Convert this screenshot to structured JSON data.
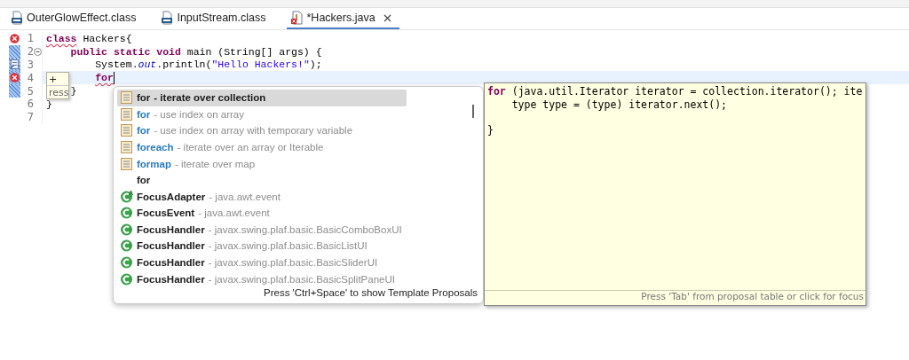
{
  "tabs": [
    {
      "label": "OuterGlowEffect.class",
      "kind": "class-file",
      "selected": false
    },
    {
      "label": "InputStream.class",
      "kind": "class-file",
      "selected": false
    },
    {
      "label": "*Hackers.java",
      "kind": "java-file-error",
      "selected": true
    }
  ],
  "editor": {
    "lines": [
      {
        "number": "1",
        "error": true,
        "task": false,
        "changed": false,
        "fold": false,
        "current": false,
        "tokens": [
          {
            "text": "class",
            "kind": "keyword-squiggle"
          },
          {
            "text": " Hackers{",
            "kind": "plain"
          }
        ]
      },
      {
        "number": "2",
        "error": false,
        "task": false,
        "changed": true,
        "fold": true,
        "current": false,
        "tokens": [
          {
            "text": "    public static void",
            "kind": "keyword"
          },
          {
            "text": " main (String[] args) {",
            "kind": "plain"
          }
        ]
      },
      {
        "number": "3",
        "error": false,
        "task": true,
        "changed": true,
        "fold": false,
        "current": false,
        "tokens": [
          {
            "text": "        System.",
            "kind": "plain"
          },
          {
            "text": "out",
            "kind": "field"
          },
          {
            "text": ".println(",
            "kind": "plain"
          },
          {
            "text": "\"Hello Hackers!\"",
            "kind": "string"
          },
          {
            "text": ");",
            "kind": "plain"
          }
        ]
      },
      {
        "number": "4",
        "error": true,
        "task": false,
        "changed": true,
        "fold": false,
        "current": true,
        "tokens": [
          {
            "text": "        for",
            "kind": "keyword-squiggle"
          }
        ]
      },
      {
        "number": "5",
        "error": false,
        "task": false,
        "changed": true,
        "fold": false,
        "current": false,
        "tokens": [
          {
            "text": "    }",
            "kind": "plain"
          }
        ]
      },
      {
        "number": "6",
        "error": false,
        "task": false,
        "changed": false,
        "fold": false,
        "current": false,
        "tokens": [
          {
            "text": "}",
            "kind": "plain"
          }
        ]
      },
      {
        "number": "7",
        "error": false,
        "task": false,
        "changed": false,
        "fold": false,
        "current": false
      }
    ],
    "hover_tooltip": [
      "+",
      "ress"
    ]
  },
  "proposals": {
    "items": [
      {
        "kind": "template",
        "name": "for",
        "detail": "- iterate over collection",
        "selected": true
      },
      {
        "kind": "template",
        "name": "for",
        "detail": "- use index on array",
        "selected": false
      },
      {
        "kind": "template",
        "name": "for",
        "detail": "- use index on array with temporary variable",
        "selected": false
      },
      {
        "kind": "template",
        "name": "foreach",
        "detail": "- iterate over an array or Iterable",
        "selected": false
      },
      {
        "kind": "template",
        "name": "formap",
        "detail": "- iterate over map",
        "selected": false
      },
      {
        "kind": "keyword",
        "name": "for",
        "selected": false
      },
      {
        "kind": "abstract-class",
        "name": "FocusAdapter",
        "detail": "- java.awt.event",
        "selected": false
      },
      {
        "kind": "class",
        "name": "FocusEvent",
        "detail": "- java.awt.event",
        "selected": false
      },
      {
        "kind": "class",
        "name": "FocusHandler",
        "detail": "- javax.swing.plaf.basic.BasicComboBoxUI",
        "selected": false
      },
      {
        "kind": "class",
        "name": "FocusHandler",
        "detail": "- javax.swing.plaf.basic.BasicListUI",
        "selected": false
      },
      {
        "kind": "class",
        "name": "FocusHandler",
        "detail": "- javax.swing.plaf.basic.BasicSliderUI",
        "selected": false
      },
      {
        "kind": "class",
        "name": "FocusHandler",
        "detail": "- javax.swing.plaf.basic.BasicSplitPaneUI",
        "selected": false
      }
    ],
    "footer": "Press 'Ctrl+Space' to show Template Proposals"
  },
  "preview": {
    "lines": [
      [
        {
          "text": "for",
          "kind": "keyword"
        },
        {
          "text": " (java.util.Iterator iterator = collection.iterator(); ite",
          "kind": "plain"
        }
      ],
      [
        {
          "text": "    type type = (type) iterator.next();",
          "kind": "plain"
        }
      ],
      [
        {
          "text": "\n}",
          "kind": "plain"
        }
      ]
    ],
    "footer": "Press 'Tab' from proposal table or click for focus"
  }
}
